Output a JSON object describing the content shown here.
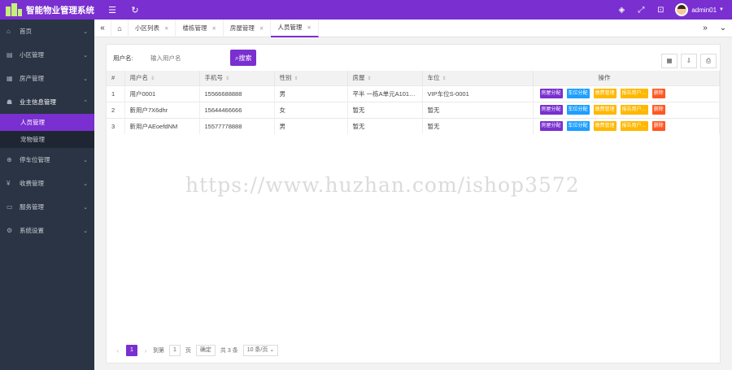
{
  "app": {
    "title": "智能物业管理系统"
  },
  "topbar": {
    "username": "admin01"
  },
  "sidebar": {
    "items": [
      {
        "label": "首页"
      },
      {
        "label": "小区管理"
      },
      {
        "label": "房产管理"
      },
      {
        "label": "业主信息管理",
        "sub": [
          {
            "label": "人员管理"
          },
          {
            "label": "宠物管理"
          }
        ]
      },
      {
        "label": "停车位管理"
      },
      {
        "label": "收费管理"
      },
      {
        "label": "服务管理"
      },
      {
        "label": "系统设置"
      }
    ]
  },
  "tabs": [
    {
      "label": "小区列表"
    },
    {
      "label": "楼栋管理"
    },
    {
      "label": "房屋管理"
    },
    {
      "label": "人员管理"
    }
  ],
  "search": {
    "label": "用户名:",
    "placeholder": "输入用户名",
    "button": "搜索"
  },
  "table": {
    "headers": [
      "#",
      "用户名",
      "手机号",
      "性别",
      "房屋",
      "车位",
      "操作"
    ],
    "actions": [
      "房屋分配",
      "车位分配",
      "缴费管理",
      "报告用户…",
      "删除"
    ],
    "rows": [
      {
        "idx": "1",
        "username": "用户0001",
        "phone": "15566688888",
        "gender": "男",
        "house": "平半 一栋A单元A101…",
        "parking": "VIP车位S-0001"
      },
      {
        "idx": "2",
        "username": "新用户7X6dhr",
        "phone": "15644466666",
        "gender": "女",
        "house": "暂无",
        "parking": "暂无"
      },
      {
        "idx": "3",
        "username": "新用户AEoefdNM",
        "phone": "15577778888",
        "gender": "男",
        "house": "暂无",
        "parking": "暂无"
      }
    ]
  },
  "pager": {
    "current": "1",
    "goto_label": "到第",
    "goto_value": "1",
    "page_unit": "页",
    "confirm": "确定",
    "total": "共 3 条",
    "page_size": "10 条/页"
  },
  "watermark": "https://www.huzhan.com/ishop3572"
}
